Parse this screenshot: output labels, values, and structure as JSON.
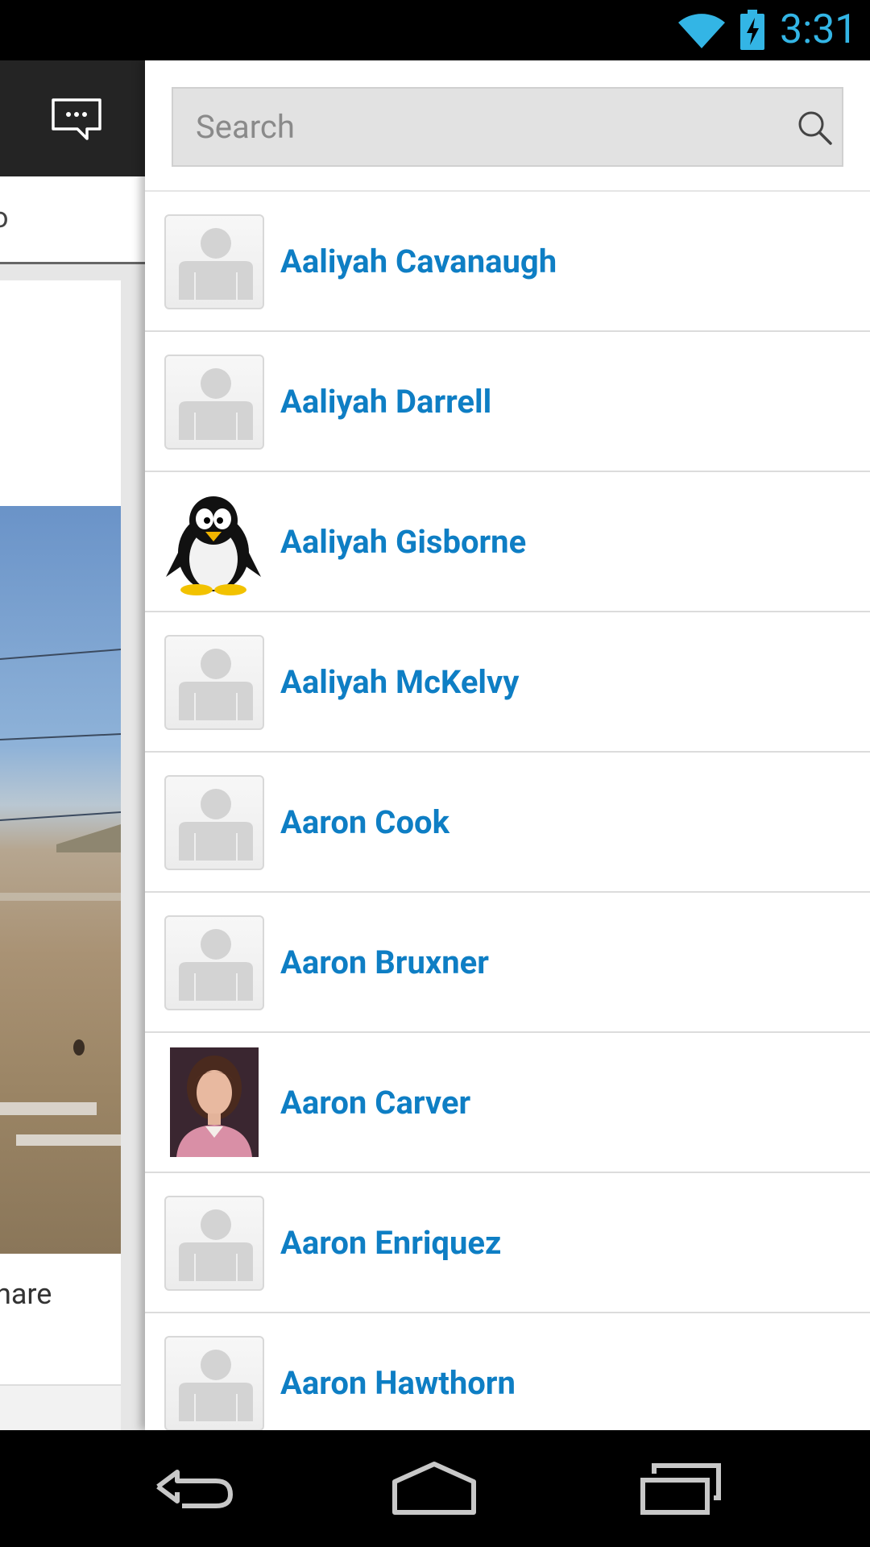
{
  "status_bar": {
    "time": "3:31",
    "icons": [
      "wifi-icon",
      "battery-charging-icon"
    ],
    "accent_color": "#33b5e5"
  },
  "background_app": {
    "action_icon": "chat-bubble-icon",
    "tab_label_fragment": "o",
    "share_label_fragment": "hare"
  },
  "drawer": {
    "search": {
      "placeholder": "Search",
      "value": "",
      "icon": "search-icon"
    },
    "name_color": "#0e7ec4",
    "contacts": [
      {
        "name": "Aaliyah Cavanaugh",
        "avatar": "default-avatar"
      },
      {
        "name": "Aaliyah Darrell",
        "avatar": "default-avatar"
      },
      {
        "name": "Aaliyah Gisborne",
        "avatar": "penguin-avatar"
      },
      {
        "name": "Aaliyah McKelvy",
        "avatar": "default-avatar"
      },
      {
        "name": "Aaron Cook",
        "avatar": "default-avatar"
      },
      {
        "name": "Aaron Bruxner",
        "avatar": "default-avatar"
      },
      {
        "name": "Aaron Carver",
        "avatar": "photo-avatar"
      },
      {
        "name": "Aaron Enriquez",
        "avatar": "default-avatar"
      },
      {
        "name": "Aaron Hawthorn",
        "avatar": "default-avatar"
      }
    ]
  },
  "nav_bar": {
    "buttons": [
      "back-icon",
      "home-icon",
      "recent-apps-icon"
    ]
  }
}
